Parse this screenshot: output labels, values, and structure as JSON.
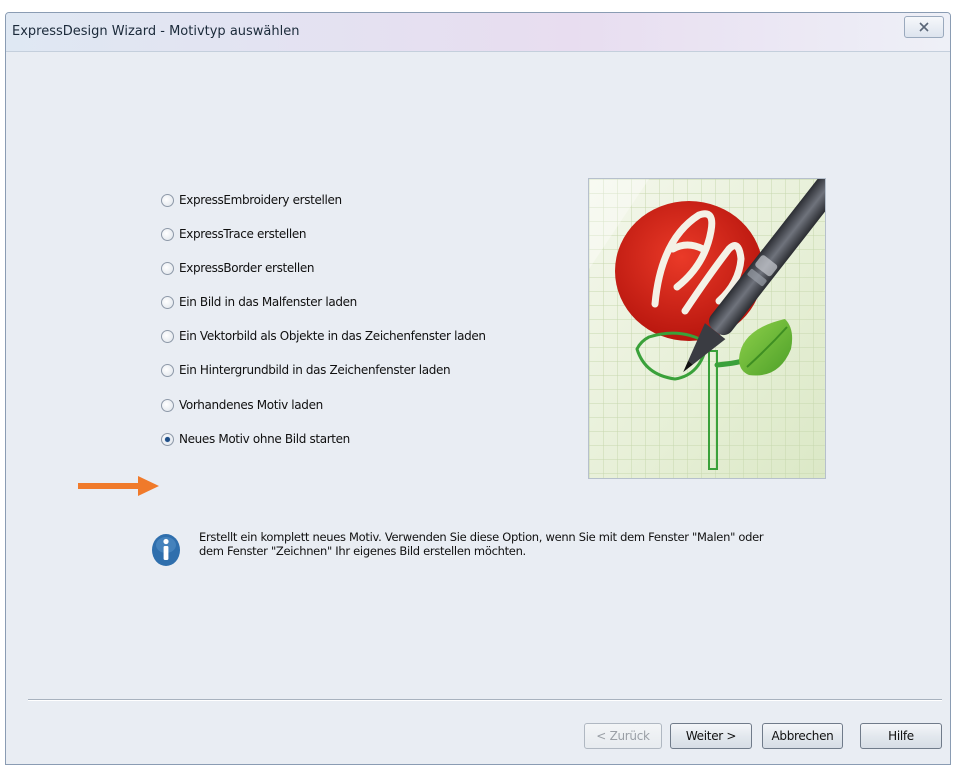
{
  "window": {
    "title": "ExpressDesign Wizard - Motivtyp auswählen"
  },
  "options": [
    {
      "label": "ExpressEmbroidery erstellen",
      "checked": false
    },
    {
      "label": "ExpressTrace erstellen",
      "checked": false
    },
    {
      "label": "ExpressBorder erstellen",
      "checked": false
    },
    {
      "label": "Ein Bild in das Malfenster laden",
      "checked": false
    },
    {
      "label": "Ein Vektorbild als Objekte in das Zeichenfenster laden",
      "checked": false
    },
    {
      "label": "Ein Hintergrundbild in das Zeichenfenster laden",
      "checked": false
    },
    {
      "label": "Vorhandenes Motiv laden",
      "checked": false
    },
    {
      "label": "Neues Motiv ohne Bild starten",
      "checked": true
    }
  ],
  "info": {
    "line1": "Erstellt ein komplett neues Motiv. Verwenden Sie diese Option, wenn Sie mit dem Fenster \"Malen\" oder",
    "line2": "dem Fenster \"Zeichnen\" Ihr eigenes Bild erstellen möchten."
  },
  "buttons": {
    "back": "< Zurück",
    "next": "Weiter >",
    "cancel": "Abbrechen",
    "help": "Hilfe"
  },
  "colors": {
    "arrow": "#f07a2a",
    "info_icon": "#2f6fad",
    "flower_red": "#d8261c",
    "leaf_green": "#6fbf3a"
  },
  "icons": {
    "close": "close-icon",
    "info": "info-icon",
    "arrow": "arrow-right-icon"
  }
}
